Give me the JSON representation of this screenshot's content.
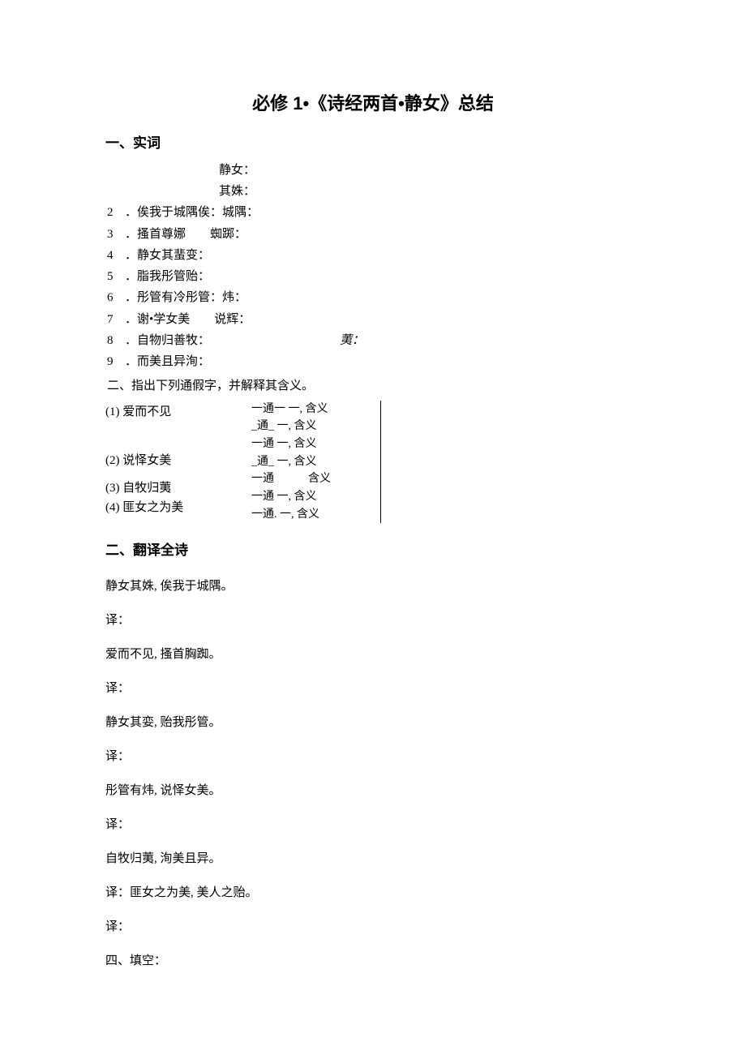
{
  "title": "必修 1•《诗经两首•静女》总结",
  "sec1": {
    "head": "一、实词",
    "l1a": "静女：",
    "l1b": "其姝：",
    "items": [
      "．俟我于城隅俟：城隅：",
      "．搔首尊娜　　蜘踯：",
      "．静女其蜚变：",
      "．脂我彤管贻：",
      "．彤管有冷彤管：炜：",
      "．谢•学女美　　说辉：",
      "．自物归善牧：",
      "．而美且异洵："
    ],
    "italic": "荑：",
    "subhead": "二、指出下列通假字，并解释其含义。",
    "tj_left": [
      "(1) 爱而不见",
      "(2) 说怿女美",
      "(3) 自牧归荑",
      "(4) 匪女之为美"
    ],
    "tj_right": [
      "一通一  一, 含义",
      "_通_  一, 含义",
      "一通   一, 含义",
      "_通_  一, 含义",
      "一通　　　含义",
      "一通   一, 含义",
      "一通.  一, 含义"
    ]
  },
  "sec2": {
    "head": "二、翻译全诗",
    "lines": [
      "静女其姝, 俟我于城隅。",
      "译：",
      "爱而不见, 搔首胸踟。",
      "译：",
      "静女其娈, 贻我彤管。",
      "译：",
      "彤管有炜, 说怿女美。",
      "译：",
      "自牧归荑, 洵美且异。",
      "译：匪女之为美, 美人之贻。",
      "译：",
      "四、填空："
    ]
  }
}
